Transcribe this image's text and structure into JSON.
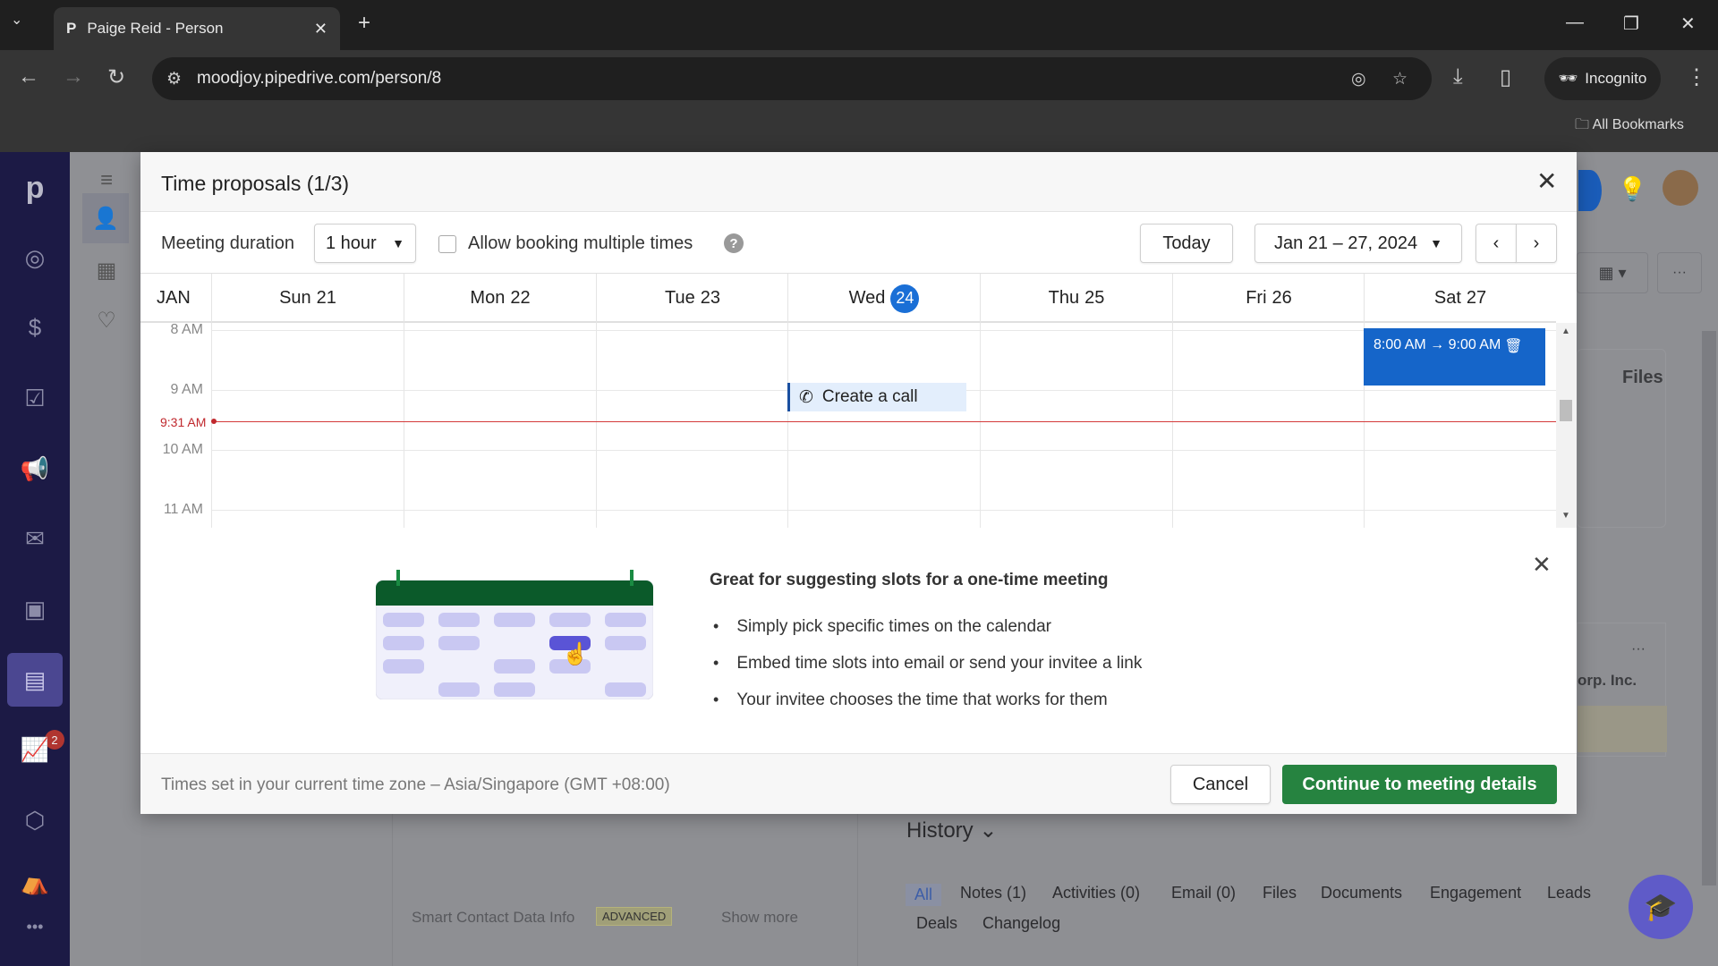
{
  "browser": {
    "tab_title": "Paige Reid - Person",
    "url": "moodjoy.pipedrive.com/person/8",
    "incognito_label": "Incognito",
    "bookmarks_label": "All Bookmarks"
  },
  "sidebar": {
    "logo": "p",
    "notification_count": "2"
  },
  "modal": {
    "title": "Time proposals (1/3)",
    "meeting_duration_label": "Meeting duration",
    "duration_value": "1 hour",
    "allow_multiple_label": "Allow booking multiple times",
    "allow_multiple_checked": false,
    "today_label": "Today",
    "date_range": "Jan 21 – 27, 2024",
    "month": "JAN",
    "days": [
      {
        "name": "Sun",
        "num": "21"
      },
      {
        "name": "Mon",
        "num": "22"
      },
      {
        "name": "Tue",
        "num": "23"
      },
      {
        "name": "Wed",
        "num": "24",
        "today": true
      },
      {
        "name": "Thu",
        "num": "25"
      },
      {
        "name": "Fri",
        "num": "26"
      },
      {
        "name": "Sat",
        "num": "27"
      }
    ],
    "hours": [
      "8 AM",
      "9 AM",
      "10 AM",
      "11 AM"
    ],
    "now_label": "9:31 AM",
    "create_call_label": "Create a call",
    "slot": {
      "day": "Sat 27",
      "label": "8:00 AM → 9:00 AM"
    },
    "info": {
      "heading": "Great for suggesting slots for a one-time meeting",
      "bullets": [
        "Simply pick specific times on the calendar",
        "Embed time slots into email or send your invitee a link",
        "Your invitee chooses the time that works for them"
      ]
    },
    "timezone_note": "Times set in your current time zone – Asia/Singapore (GMT +08:00)",
    "cancel_label": "Cancel",
    "continue_label": "Continue to meeting details"
  },
  "background": {
    "files_label": "Files",
    "org_fragment": "orp. Inc.",
    "history_label": "History",
    "history_tabs": [
      "All",
      "Notes (1)",
      "Activities (0)",
      "Email (0)",
      "Files",
      "Documents",
      "Engagement",
      "Leads",
      "Deals",
      "Changelog"
    ],
    "smart_contact_label": "Smart Contact Data Info",
    "advanced_badge": "ADVANCED",
    "show_more_label": "Show more"
  },
  "colors": {
    "primary": "#1565c9",
    "success": "#268340",
    "now_line": "#d43b3b",
    "sidebar": "#1c1a45"
  }
}
